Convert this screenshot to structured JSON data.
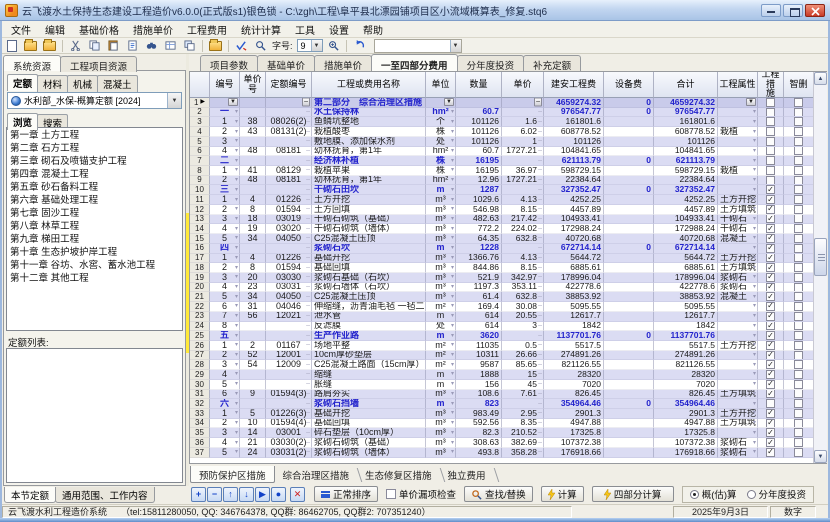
{
  "window": {
    "title": "云飞渡水土保持生态建设工程造价v6.0.0(正式版s1)银色锁 - C:\\zgh\\工程\\阜平县北漂园铺项目区小流域概算表_修复.stq6"
  },
  "glyphs": {
    "down": "▼",
    "dropdown": "▾",
    "dash": "–",
    "current": "▶",
    "check": "✓",
    "up": "▲"
  },
  "menu": {
    "items": [
      "文件",
      "编辑",
      "基础价格",
      "措施单价",
      "工程费用",
      "统计计算",
      "工具",
      "设置",
      "帮助"
    ]
  },
  "toolbar": {
    "font_label": "字号:",
    "font_value": "9"
  },
  "left": {
    "top_tabs": [
      "系统资源",
      "工程项目资源"
    ],
    "top_active": 0,
    "res_tabs": [
      "定额",
      "材料",
      "机械",
      "混凝土"
    ],
    "res_active": 0,
    "quota_select": "水利部_水保-概算定额 [2024]",
    "browse_tabs": [
      "浏览",
      "搜索"
    ],
    "browse_active": 0,
    "chapters": [
      "第一章 土方工程",
      "第二章 石方工程",
      "第三章 砌石及喷锚支护工程",
      "第四章 混凝土工程",
      "第五章 砂石备料工程",
      "第六章 基础处理工程",
      "第七章 固沙工程",
      "第八章 林草工程",
      "第九章 梯田工程",
      "第十章 生态护坡护岸工程",
      "第十一章 谷坊、水窖、蓄水池工程",
      "第十二章 其他工程"
    ],
    "quota_list_label": "定额列表:",
    "bottom_tabs": [
      "本节定额",
      "通用范围、工作内容"
    ],
    "bottom_active": 0
  },
  "main": {
    "tabs": [
      "项目参数",
      "基础单价",
      "措施单价",
      "一至四部分费用",
      "分年度投资",
      "补充定额"
    ],
    "active_tab": 3,
    "grid": {
      "columns": [
        "",
        "编号",
        "单价\n号",
        "定额编号",
        "工程或费用名称",
        "单位",
        "数量",
        "单价",
        "建安工程费",
        "设备费",
        "合计",
        "工程属性",
        "工程措\n施",
        "智删"
      ],
      "rows": [
        [
          "p",
          "",
          "",
          "",
          "第二部分　综合治理区措施",
          "",
          "",
          "",
          "4659274.32",
          "0",
          "4659274.32",
          "",
          0
        ],
        [
          "g",
          "一",
          "",
          "",
          "水土保持林",
          "hm²",
          "60.7",
          "",
          "976547.77",
          "0",
          "976547.77",
          "",
          0
        ],
        [
          "n",
          "1",
          "38",
          "08026(2)",
          "鱼鳞坑整地",
          "个",
          "101126",
          "1.6",
          "161801.6",
          "",
          "161801.6",
          "",
          0
        ],
        [
          "n",
          "2",
          "43",
          "08131(2)",
          "栽植酸枣",
          "株",
          "101126",
          "6.02",
          "608778.52",
          "",
          "608778.52",
          "栽植",
          0
        ],
        [
          "n",
          "3",
          "",
          "",
          "敷地膜、添加保水剂",
          "处",
          "101126",
          "1",
          "101126",
          "",
          "101126",
          "",
          0
        ],
        [
          "n",
          "4",
          "48",
          "08181",
          "幼林抚育，第1年",
          "hm²",
          "60.7",
          "1727.21",
          "104841.65",
          "",
          "104841.65",
          "",
          0
        ],
        [
          "g",
          "二",
          "",
          "",
          "经济林补植",
          "株",
          "16195",
          "",
          "621113.79",
          "0",
          "621113.79",
          "",
          0
        ],
        [
          "n",
          "1",
          "41",
          "08129",
          "栽植苹果",
          "株",
          "16195",
          "36.97",
          "598729.15",
          "",
          "598729.15",
          "栽植",
          0
        ],
        [
          "n",
          "2",
          "48",
          "08181",
          "幼林抚育，第1年",
          "hm²",
          "12.96",
          "1727.21",
          "22384.64",
          "",
          "22384.64",
          "",
          0
        ],
        [
          "g",
          "三",
          "",
          "",
          "干砌石田坎",
          "m",
          "1287",
          "",
          "327352.47",
          "0",
          "327352.47",
          "",
          1
        ],
        [
          "n",
          "1",
          "4",
          "01226",
          "土方开挖",
          "m³",
          "1029.6",
          "4.13",
          "4252.25",
          "",
          "4252.25",
          "土方开挖",
          1
        ],
        [
          "n",
          "2",
          "8",
          "01594",
          "土方回填",
          "m³",
          "546.98",
          "8.15",
          "4457.89",
          "",
          "4457.89",
          "土方填筑",
          1
        ],
        [
          "n",
          "3",
          "18",
          "03019",
          "干砌石砌筑（基础）",
          "m³",
          "482.63",
          "217.42",
          "104933.41",
          "",
          "104933.41",
          "干砌石",
          1
        ],
        [
          "n",
          "4",
          "19",
          "03020",
          "干砌石砌筑（墙体）",
          "m³",
          "772.2",
          "224.02",
          "172988.24",
          "",
          "172988.24",
          "干砌石",
          1
        ],
        [
          "n",
          "5",
          "34",
          "04050",
          "C25混凝土压顶",
          "m³",
          "64.35",
          "632.8",
          "40720.68",
          "",
          "40720.68",
          "混凝土",
          1
        ],
        [
          "g",
          "四",
          "",
          "",
          "浆砌石坎",
          "m",
          "1228",
          "",
          "672714.14",
          "0",
          "672714.14",
          "",
          1
        ],
        [
          "n",
          "1",
          "4",
          "01226",
          "基础开挖",
          "m³",
          "1366.76",
          "4.13",
          "5644.72",
          "",
          "5644.72",
          "土方开挖",
          1
        ],
        [
          "n",
          "2",
          "8",
          "01594",
          "基础回填",
          "m³",
          "844.86",
          "8.15",
          "6885.61",
          "",
          "6885.61",
          "土方填筑",
          1
        ],
        [
          "n",
          "3",
          "20",
          "03030",
          "浆砌石基础（石坎）",
          "m³",
          "521.9",
          "342.97",
          "178996.04",
          "",
          "178996.04",
          "浆砌石",
          1
        ],
        [
          "n",
          "4",
          "23",
          "03031",
          "浆砌石墙体（石坎）",
          "m³",
          "1197.3",
          "353.11",
          "422778.6",
          "",
          "422778.6",
          "浆砌石",
          1
        ],
        [
          "n",
          "5",
          "34",
          "04050",
          "C25混凝土压顶",
          "m³",
          "61.4",
          "632.8",
          "38853.92",
          "",
          "38853.92",
          "混凝土",
          1
        ],
        [
          "n",
          "6",
          "31",
          "04046",
          "伸缩缝，沥青油毛毡 一毡二油",
          "m²",
          "169.4",
          "30.08",
          "5095.55",
          "",
          "5095.55",
          "",
          1
        ],
        [
          "n",
          "7",
          "56",
          "12021",
          "泄水管",
          "m",
          "614",
          "20.55",
          "12617.7",
          "",
          "12617.7",
          "",
          1
        ],
        [
          "n",
          "8",
          "",
          "",
          "反滤膜",
          "处",
          "614",
          "3",
          "1842",
          "",
          "1842",
          "",
          1
        ],
        [
          "g",
          "五",
          "",
          "",
          "生产作业路",
          "m",
          "3620",
          "",
          "1137701.76",
          "0",
          "1137701.76",
          "",
          1
        ],
        [
          "n",
          "1",
          "2",
          "01167",
          "场地平整",
          "m²",
          "11035",
          "0.5",
          "5517.5",
          "",
          "5517.5",
          "土方开挖",
          1
        ],
        [
          "n",
          "2",
          "52",
          "12001",
          "10cm厚砂垫层",
          "m²",
          "10311",
          "26.66",
          "274891.26",
          "",
          "274891.26",
          "",
          1
        ],
        [
          "n",
          "3",
          "54",
          "12009",
          "C25混凝土路面（15cm厚）",
          "m²",
          "9587",
          "85.65",
          "821126.55",
          "",
          "821126.55",
          "",
          1
        ],
        [
          "n",
          "4",
          "",
          "",
          "缩缝",
          "m",
          "1888",
          "15",
          "28320",
          "",
          "28320",
          "",
          1
        ],
        [
          "n",
          "5",
          "",
          "",
          "胀缝",
          "m",
          "156",
          "45",
          "7020",
          "",
          "7020",
          "",
          1
        ],
        [
          "n",
          "6",
          "9",
          "01594(3)",
          "路肩夯实",
          "m³",
          "108.6",
          "7.61",
          "826.45",
          "",
          "826.45",
          "土方填筑",
          1
        ],
        [
          "g",
          "六",
          "",
          "",
          "浆砌石挡墙",
          "m",
          "823",
          "",
          "354964.46",
          "0",
          "354964.46",
          "",
          0
        ],
        [
          "n",
          "1",
          "5",
          "01226(3)",
          "基础开挖",
          "m³",
          "983.49",
          "2.95",
          "2901.3",
          "",
          "2901.3",
          "土方开挖",
          1
        ],
        [
          "n",
          "2",
          "10",
          "01594(4)",
          "基础回填",
          "m³",
          "592.56",
          "8.35",
          "4947.88",
          "",
          "4947.88",
          "土方填筑",
          1
        ],
        [
          "n",
          "3",
          "14",
          "03001",
          "碎石垫层（10cm厚）",
          "m³",
          "82.3",
          "210.52",
          "17325.8",
          "",
          "17325.8",
          "",
          1
        ],
        [
          "n",
          "4",
          "21",
          "03030(2)",
          "浆砌石砌筑（基础）",
          "m³",
          "308.63",
          "382.69",
          "107372.38",
          "",
          "107372.38",
          "浆砌石",
          1
        ],
        [
          "n",
          "5",
          "24",
          "03031(2)",
          "浆砌石砌筑（墙体）",
          "m³",
          "493.8",
          "358.28",
          "176918.66",
          "",
          "176918.66",
          "浆砌石",
          1
        ]
      ]
    },
    "sheet_tabs": [
      "预防保护区措施",
      "综合治理区措施",
      "生态修复区措施",
      "独立费用"
    ],
    "sheet_active": 0,
    "footer": {
      "nav": [
        "+",
        "−",
        "↑",
        "↓",
        "▶",
        "●"
      ],
      "delete_glyph": "✕",
      "sort_label": "正常排序",
      "check_label": "单价漏项检查",
      "find_label": "查找/替换",
      "calc_label": "计算",
      "calc4_label": "四部分计算",
      "radio1": "概(估)算",
      "radio2": "分年度投资"
    }
  },
  "status": {
    "app": "云飞渡水利工程造价系统",
    "contact": "（tel:15811280050, QQ: 346764378, QQ群: 86462705, QQ群2: 707351240）",
    "date": "2025年9月3日",
    "mode": "数字"
  },
  "colors": {
    "accent_blue": "#2323cc",
    "row_lavender": "#dbdcf3",
    "row_selected": "#c9cbea",
    "titlebar_blue": "#c2d6f0",
    "splitter_yellow": "#ffe93a"
  }
}
